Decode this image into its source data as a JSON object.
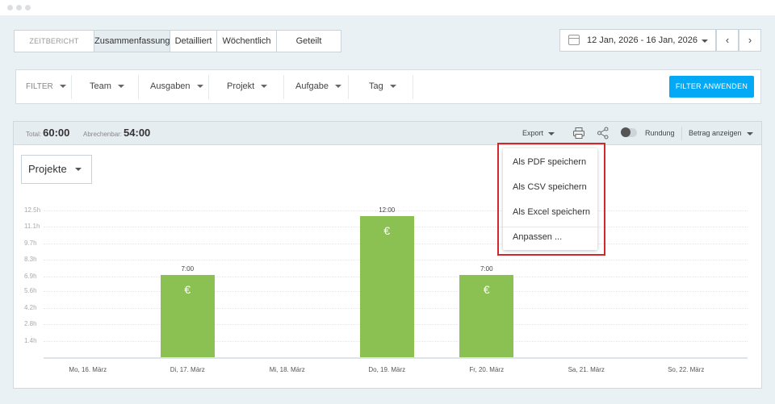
{
  "tabs": {
    "label": "ZEITBERICHT",
    "items": [
      "Zusammenfassung",
      "Detailliert",
      "Wöchentlich",
      "Geteilt"
    ],
    "active": "Zusammenfassung"
  },
  "date_range": {
    "value": "12 Jan, 2026 - 16 Jan, 2026",
    "prev": "‹",
    "next": "›"
  },
  "filter": {
    "label": "FILTER",
    "team": "Team",
    "expenses": "Ausgaben",
    "project": "Projekt",
    "task": "Aufgabe",
    "tag": "Tag",
    "apply": "FILTER ANWENDEN"
  },
  "summary": {
    "total_label": "Total:",
    "total_value": "60:00",
    "billable_label": "Abrechenbar:",
    "billable_value": "54:00",
    "export": "Export",
    "rounding": "Rundung",
    "show_amount": "Betrag anzeigen"
  },
  "group_by": "Projekte",
  "export_menu": {
    "items": [
      "Als PDF speichern",
      "Als CSV speichern",
      "Als Excel speichern",
      "Anpassen ..."
    ]
  },
  "colors": {
    "bar": "#8bc152",
    "accent": "#03a9f4",
    "highlight": "#d0282b"
  },
  "chart_data": {
    "type": "bar",
    "categories": [
      "Mo, 16. März",
      "Di, 17. März",
      "Mi, 18. März",
      "Do, 19. März",
      "Fr, 20. März",
      "Sa, 21. März",
      "So, 22. März"
    ],
    "values": [
      0,
      7,
      0,
      12,
      7,
      0,
      0
    ],
    "value_labels": [
      "",
      "7:00",
      "",
      "12:00",
      "7:00",
      "",
      ""
    ],
    "bar_icon": "€",
    "y_ticks": [
      "12.5h",
      "11.1h",
      "9.7h",
      "8.3h",
      "6.9h",
      "5.6h",
      "4.2h",
      "2.8h",
      "1.4h"
    ],
    "y_tick_values": [
      12.5,
      11.1,
      9.7,
      8.3,
      6.9,
      5.6,
      4.2,
      2.8,
      1.4
    ],
    "ylim": [
      0,
      12.5
    ],
    "grid": true
  }
}
